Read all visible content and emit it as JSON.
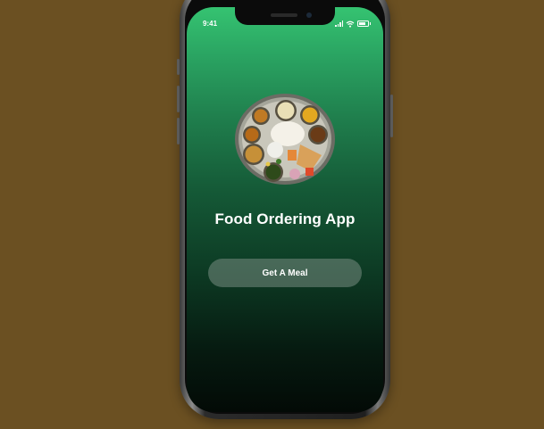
{
  "status_bar": {
    "time": "9:41"
  },
  "app": {
    "title": "Food Ordering App",
    "cta_label": "Get A Meal",
    "hero_image": "indian-thali-plate"
  },
  "colors": {
    "background": "#6b5022",
    "gradient_top": "#35c371",
    "gradient_bottom": "#030a06",
    "button_fill": "rgba(120,140,130,0.55)",
    "text": "#ffffff"
  }
}
